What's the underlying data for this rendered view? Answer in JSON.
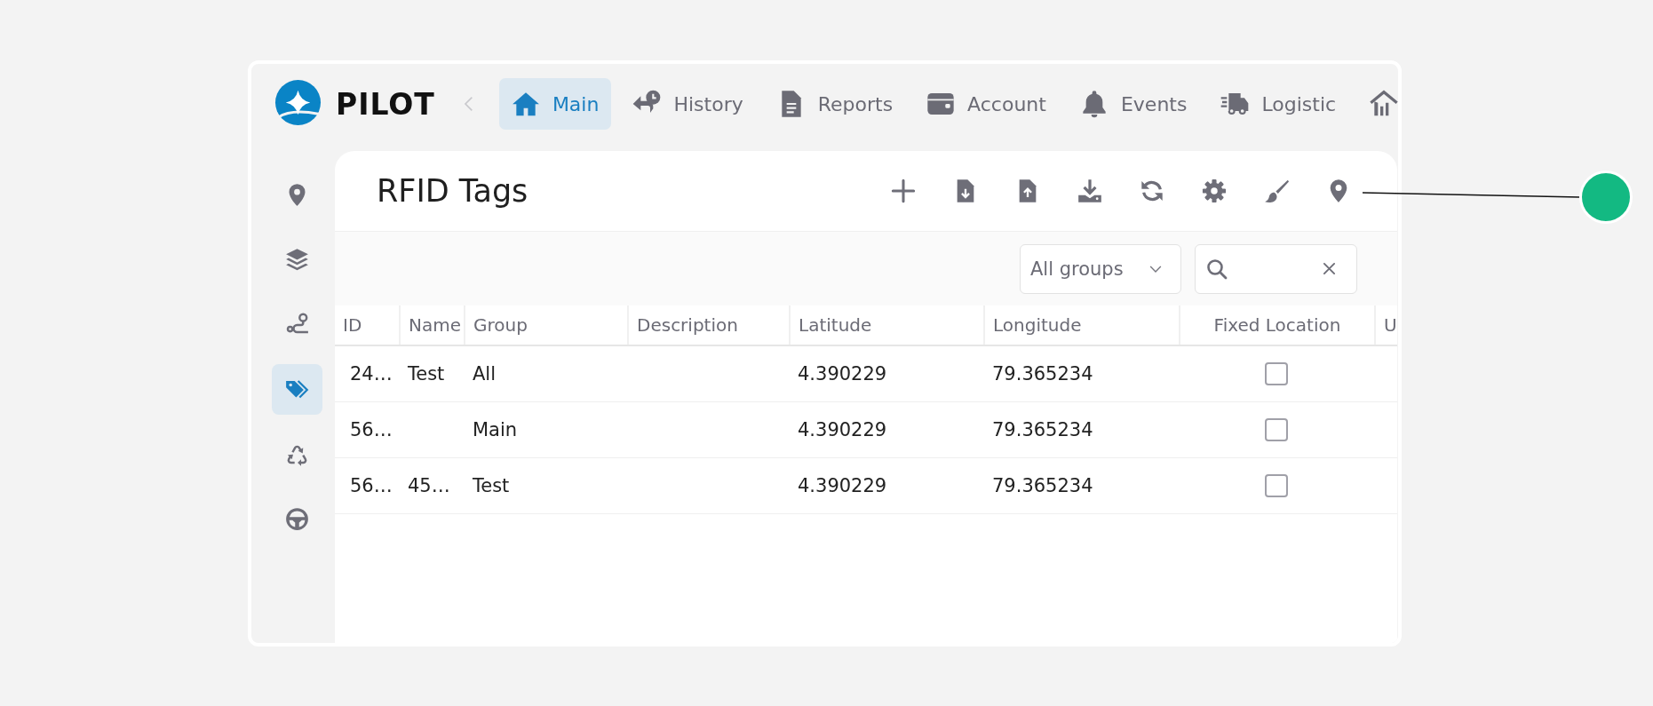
{
  "nav": {
    "brand": "PILOT",
    "tabs": [
      {
        "label": "Main",
        "selected": true
      },
      {
        "label": "History",
        "selected": false
      },
      {
        "label": "Reports",
        "selected": false
      },
      {
        "label": "Account",
        "selected": false
      },
      {
        "label": "Events",
        "selected": false
      },
      {
        "label": "Logistic",
        "selected": false
      },
      {
        "selected": false
      }
    ]
  },
  "sidebar": {
    "items": [
      {
        "selected": false
      },
      {
        "selected": false
      },
      {
        "selected": false
      },
      {
        "selected": true
      },
      {
        "selected": false
      },
      {
        "selected": false
      }
    ]
  },
  "panel": {
    "title": "RFID Tags",
    "group_filter": {
      "value": "All groups"
    },
    "table": {
      "columns": [
        {
          "label": "ID",
          "kind": "text"
        },
        {
          "label": "Name",
          "kind": "text"
        },
        {
          "label": "Group",
          "kind": "text"
        },
        {
          "label": "Description",
          "kind": "text"
        },
        {
          "label": "Latitude",
          "kind": "text"
        },
        {
          "label": "Longitude",
          "kind": "text"
        },
        {
          "label": "Fixed Location",
          "kind": "checkbox"
        },
        {
          "label": "U",
          "kind": "text"
        }
      ],
      "rows": [
        {
          "id": "24…",
          "name": "Test",
          "group": "All",
          "latitude": "4.390229",
          "longitude": "79.365234",
          "fixed_location": {
            "checked": false
          }
        },
        {
          "id": "56…",
          "group": "Main",
          "latitude": "4.390229",
          "longitude": "79.365234",
          "fixed_location": {
            "checked": false
          }
        },
        {
          "id": "56…",
          "name": "45…",
          "group": "Test",
          "latitude": "4.390229",
          "longitude": "79.365234",
          "fixed_location": {
            "checked": false
          }
        }
      ]
    }
  }
}
